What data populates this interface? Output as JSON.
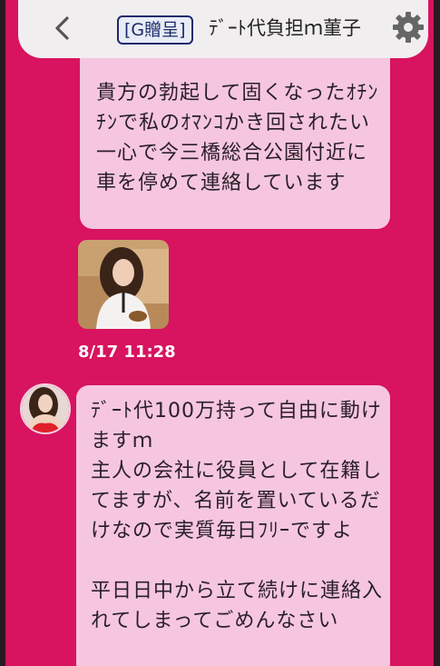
{
  "header": {
    "back_icon": "chevron-left-icon",
    "tag": "[G贈呈]",
    "contact_name": "ﾃﾞｰﾄ代負担ｍ菫子",
    "settings_icon": "gear-icon"
  },
  "messages": [
    {
      "type": "text",
      "text": "貴方の勃起して固くなったｵﾁﾝﾁﾝで私のｵﾏﾝｺかき回されたい一心で今三橋総合公園付近に車を停めて連絡しています"
    },
    {
      "type": "image",
      "timestamp": "8/17 11:28"
    },
    {
      "type": "text",
      "text": "ﾃﾞｰﾄ代100万持って自由に動けますｍ\n主人の会社に役員として在籍してますが、名前を置いているだけなので実質毎日ﾌﾘｰですよ\n\n平日日中から立て続けに連絡入れてしまってごめんなさい"
    }
  ],
  "colors": {
    "background": "#d8135f",
    "bubble": "#f6c6e0",
    "header": "#f1eef0",
    "tag_border": "#1a2a6c"
  }
}
